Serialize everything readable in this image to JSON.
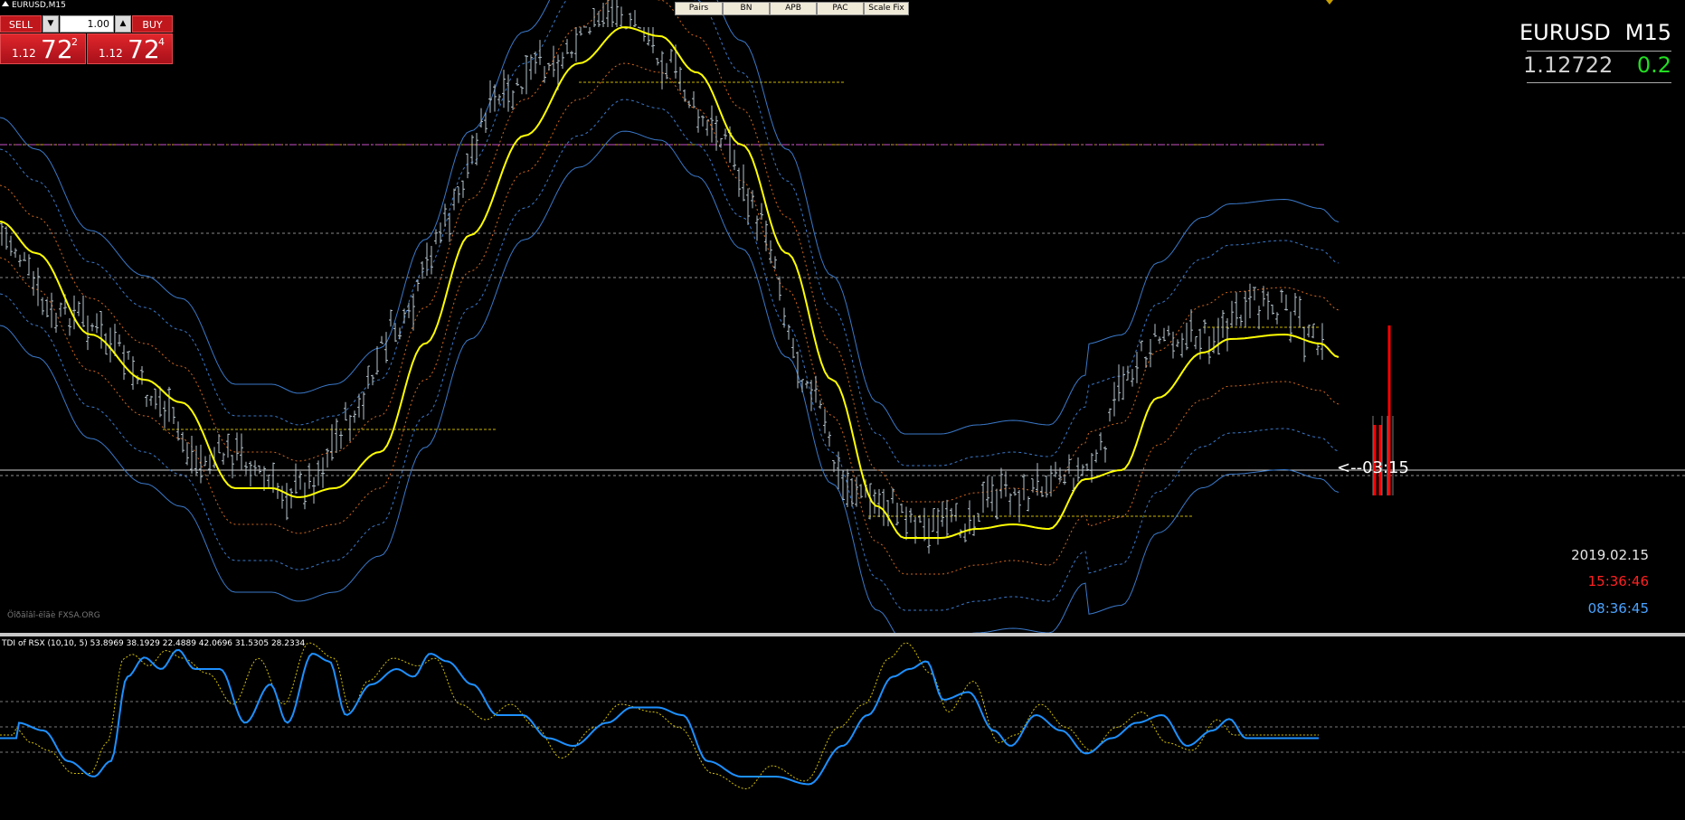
{
  "chart": {
    "title": "EURUSD,M15",
    "watermark": "Öîðãîâî-ëîãè FXSA.ORG",
    "countdown": "<--03:15",
    "date": "2019.02.15",
    "time_server": "15:36:46",
    "time_local": "08:36:45"
  },
  "trade_panel": {
    "sell_label": "SELL",
    "buy_label": "BUY",
    "lot_value": "1.00",
    "sell_prefix": "1.12",
    "sell_big": "72",
    "sell_sup": "2",
    "buy_prefix": "1.12",
    "buy_big": "72",
    "buy_sup": "4"
  },
  "toolbar": {
    "buttons": [
      "Pairs",
      "BN",
      "APB",
      "PAC",
      "Scale Fix"
    ]
  },
  "symbol_box": {
    "symbol": "EURUSD",
    "timeframe": "M15",
    "price": "1.12722",
    "spread": "0.2"
  },
  "indicator": {
    "title": "TDI of RSX  (10,10, 5) 53.8969 38.1929 22.4889 42.0696 31.5305 28.2334"
  },
  "colors": {
    "background": "#000000",
    "candle": "#b4c3cc",
    "ma_yellow": "#ffff00",
    "band_blue": "#3a78c8",
    "band_orange": "#d2691e",
    "level_yellow": "#c8b400",
    "level_magenta": "#c850c8",
    "tdi_blue": "#1e90ff",
    "tdi_signal": "#d4c000",
    "bar_red": "#ff0000"
  }
}
